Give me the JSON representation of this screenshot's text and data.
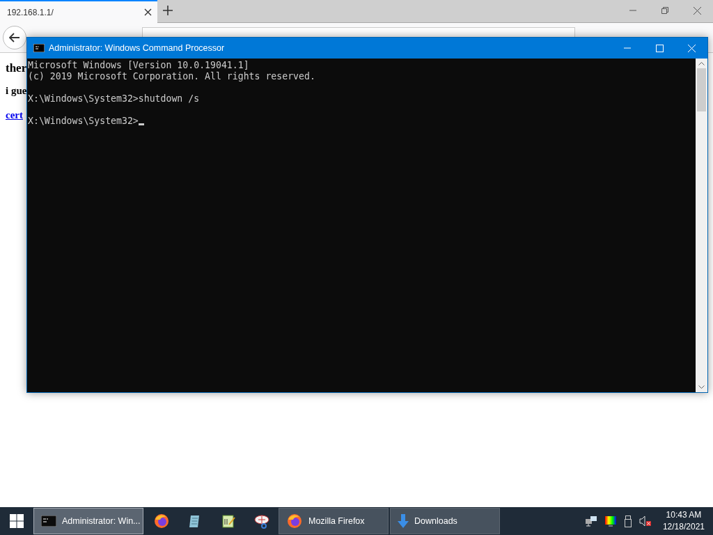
{
  "browser": {
    "tabs": [
      {
        "title": "192.168.1.1/",
        "selected": true
      }
    ],
    "page": {
      "heading": "ther",
      "text": "i gue",
      "link": "cert"
    }
  },
  "console_window": {
    "title": "Administrator: Windows Command Processor",
    "blocks": [
      [
        "Microsoft Windows [Version 10.0.19041.1]",
        "(c) 2019 Microsoft Corporation. All rights reserved."
      ],
      [
        "X:\\Windows\\System32>shutdown /s"
      ],
      [
        "X:\\Windows\\System32>"
      ]
    ],
    "cursor": true
  },
  "taskbar": {
    "items": [
      {
        "kind": "window",
        "label": "Administrator: Win...",
        "selected": true
      },
      {
        "kind": "pinned",
        "selected": false
      },
      {
        "kind": "pinned",
        "selected": false
      },
      {
        "kind": "pinned",
        "selected": false
      },
      {
        "kind": "pinned",
        "selected": false
      },
      {
        "kind": "window",
        "label": "Mozilla Firefox",
        "selected": false
      },
      {
        "kind": "window",
        "label": "Downloads",
        "selected": false
      }
    ],
    "clock": {
      "time": "10:43 AM",
      "date": "12/18/2021"
    }
  }
}
